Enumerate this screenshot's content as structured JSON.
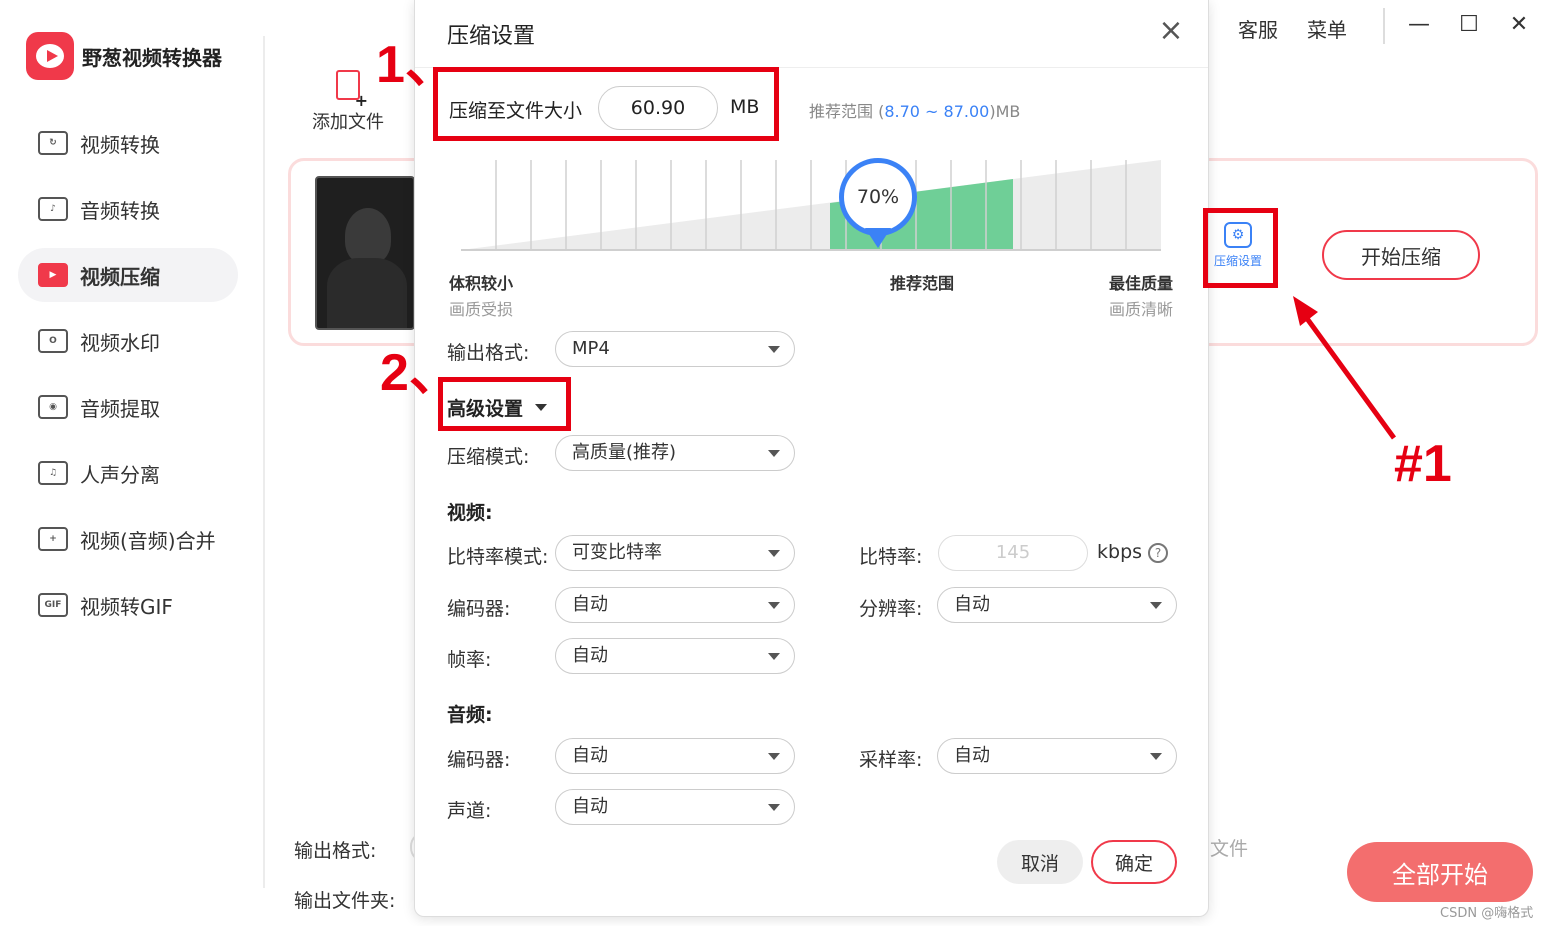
{
  "app": {
    "name": "野葱视频转换器"
  },
  "sidebar": {
    "items": [
      {
        "label": "视频转换",
        "icon": "video-convert-icon",
        "glyph": "↻"
      },
      {
        "label": "音频转换",
        "icon": "audio-convert-icon",
        "glyph": "♪"
      },
      {
        "label": "视频压缩",
        "icon": "video-compress-icon",
        "glyph": "▶",
        "active": true
      },
      {
        "label": "视频水印",
        "icon": "watermark-icon",
        "glyph": "O"
      },
      {
        "label": "音频提取",
        "icon": "audio-extract-icon",
        "glyph": "◉"
      },
      {
        "label": "人声分离",
        "icon": "vocal-separate-icon",
        "glyph": "♫"
      },
      {
        "label": "视频(音频)合并",
        "icon": "merge-icon",
        "glyph": "+"
      },
      {
        "label": "视频转GIF",
        "icon": "gif-icon",
        "glyph": "GIF"
      }
    ]
  },
  "topbar": {
    "support": "客服",
    "menu": "菜单"
  },
  "main": {
    "add_file": "添加文件",
    "file_card": {
      "settings_label": "压缩设置",
      "start_label": "开始压缩"
    },
    "output_format_label": "输出格式:",
    "output_folder_label": "输出文件夹:",
    "partial_text": "文件",
    "start_all": "全部开始"
  },
  "modal": {
    "title": "压缩设置",
    "target_label": "压缩至文件大小",
    "target_value": "60.90",
    "target_unit": "MB",
    "recommended_prefix": "推荐范围 (",
    "recommended_range": "8.70 ~ 87.00",
    "recommended_suffix": ")MB",
    "slider_percent": "70%",
    "scale": {
      "left_title": "体积较小",
      "left_sub": "画质受损",
      "mid_title": "推荐范围",
      "right_title": "最佳质量",
      "right_sub": "画质清晰"
    },
    "output_format_label": "输出格式:",
    "output_format_value": "MP4",
    "advanced_label": "高级设置",
    "compress_mode_label": "压缩模式:",
    "compress_mode_value": "高质量(推荐)",
    "video_section": "视频:",
    "bitrate_mode_label": "比特率模式:",
    "bitrate_mode_value": "可变比特率",
    "bitrate_label": "比特率:",
    "bitrate_value": "145",
    "bitrate_unit": "kbps",
    "video_codec_label": "编码器:",
    "video_codec_value": "自动",
    "resolution_label": "分辨率:",
    "resolution_value": "自动",
    "framerate_label": "帧率:",
    "framerate_value": "自动",
    "audio_section": "音频:",
    "audio_codec_label": "编码器:",
    "audio_codec_value": "自动",
    "samplerate_label": "采样率:",
    "samplerate_value": "自动",
    "channel_label": "声道:",
    "channel_value": "自动",
    "cancel": "取消",
    "ok": "确定"
  },
  "annotations": {
    "step1": "1、",
    "step2": "2、",
    "marker": "#1"
  },
  "watermark": "CSDN @嗨格式",
  "colors": {
    "brand": "#f0394a",
    "accent_blue": "#3b82f6",
    "annotation_red": "#e60012",
    "slider_green": "#6fcf97"
  }
}
